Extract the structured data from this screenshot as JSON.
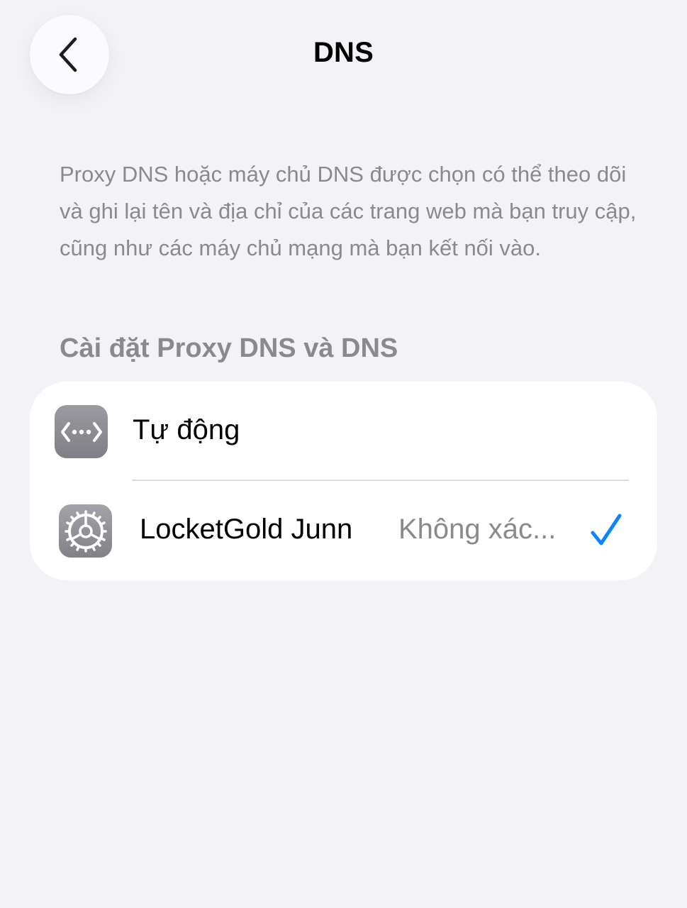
{
  "header": {
    "title": "DNS",
    "back_icon": "chevron-left-icon"
  },
  "description": "Proxy DNS hoặc máy chủ DNS được chọn có thể theo dõi và ghi lại tên và địa chỉ của các trang web mà bạn truy cập, cũng như các máy chủ mạng mà bạn kết nối vào.",
  "section": {
    "title": "Cài đặt Proxy DNS và DNS"
  },
  "options": [
    {
      "label": "Tự động",
      "icon": "dns-proxy-arrows-icon",
      "selected": false
    },
    {
      "label": "LocketGold Junn",
      "value": "Không xác...",
      "icon": "settings-gear-icon",
      "selected": true
    }
  ],
  "colors": {
    "background": "#f2f2f7",
    "card": "#ffffff",
    "secondary_text": "#8a8a8e",
    "accent": "#0a84ff"
  }
}
